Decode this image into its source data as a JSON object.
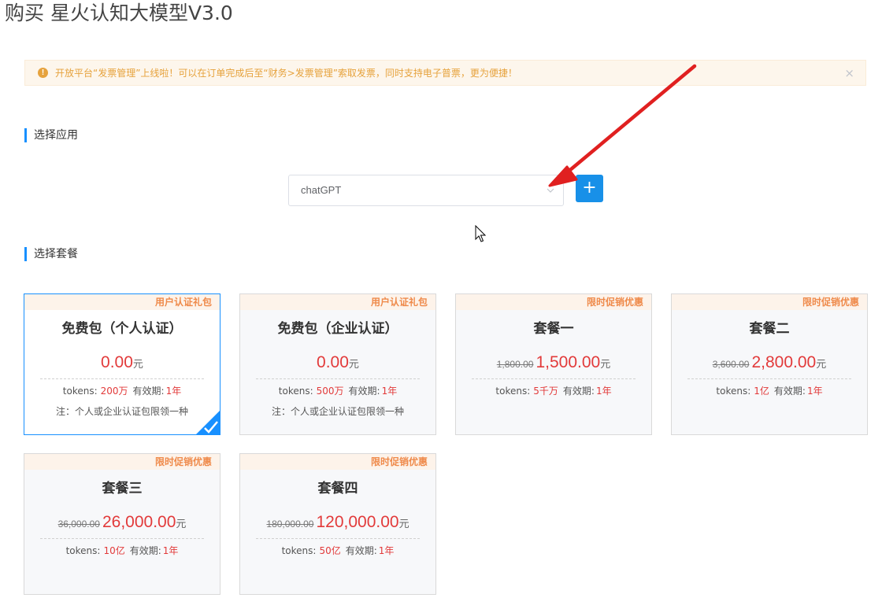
{
  "page": {
    "title": "购买 星火认知大模型V3.0"
  },
  "alert": {
    "icon": "warning-icon",
    "text": "开放平台“发票管理”上线啦！可以在订单完成后至“财务>发票管理”索取发票，同时支持电子普票，更为便捷！",
    "close": "×"
  },
  "section_app": {
    "title": "选择应用"
  },
  "app_select": {
    "value": "chatGPT",
    "add_label": "+"
  },
  "section_package": {
    "title": "选择套餐"
  },
  "labels": {
    "tokens": "tokens:",
    "validity": "有效期:",
    "yuan": "元"
  },
  "cards": [
    {
      "tag": "用户认证礼包",
      "name": "免费包（个人认证）",
      "old_price": "",
      "price": "0.00",
      "tokens": "200万",
      "validity": "1年",
      "note": "注：个人或企业认证包限领一种",
      "selected": true
    },
    {
      "tag": "用户认证礼包",
      "name": "免费包（企业认证）",
      "old_price": "",
      "price": "0.00",
      "tokens": "500万",
      "validity": "1年",
      "note": "注：个人或企业认证包限领一种",
      "selected": false
    },
    {
      "tag": "限时促销优惠",
      "name": "套餐一",
      "old_price": "1,800.00",
      "price": "1,500.00",
      "tokens": "5千万",
      "validity": "1年",
      "note": "",
      "selected": false
    },
    {
      "tag": "限时促销优惠",
      "name": "套餐二",
      "old_price": "3,600.00",
      "price": "2,800.00",
      "tokens": "1亿",
      "validity": "1年",
      "note": "",
      "selected": false
    },
    {
      "tag": "限时促销优惠",
      "name": "套餐三",
      "old_price": "36,000.00",
      "price": "26,000.00",
      "tokens": "10亿",
      "validity": "1年",
      "note": "",
      "selected": false
    },
    {
      "tag": "限时促销优惠",
      "name": "套餐四",
      "old_price": "180,000.00",
      "price": "120,000.00",
      "tokens": "50亿",
      "validity": "1年",
      "note": "",
      "selected": false
    }
  ],
  "colors": {
    "accent": "#1890ff",
    "price_red": "#e23a3a",
    "tag_orange": "#ef8a4a",
    "alert_orange": "#e6a23c"
  }
}
